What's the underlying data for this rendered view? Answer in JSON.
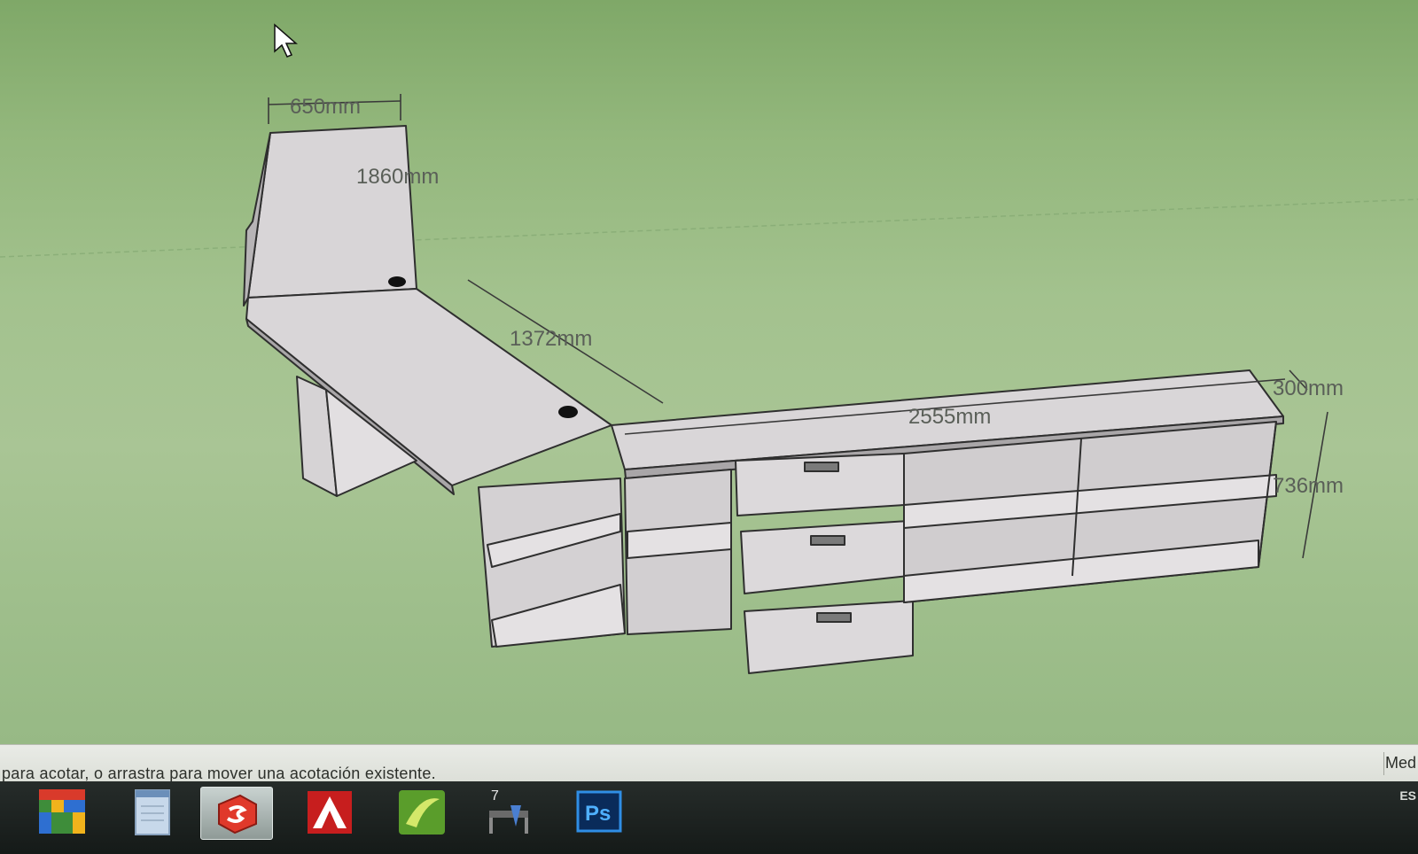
{
  "viewport": {
    "dimensions": {
      "depth_top": "650mm",
      "length_top": "1860mm",
      "length_mid": "1372mm",
      "length_main": "2555mm",
      "depth_main": "300mm",
      "height_main": "736mm"
    }
  },
  "statusbar": {
    "text": "para acotar, o arrastra para mover una acotación existente.",
    "measure_label": "Med"
  },
  "taskbar": {
    "apps": [
      {
        "name": "start-button",
        "icon": "windows-start-icon"
      },
      {
        "name": "notepad",
        "icon": "notepad-icon"
      },
      {
        "name": "sketchup",
        "icon": "sketchup-icon",
        "active": true
      },
      {
        "name": "autocad",
        "icon": "autocad-icon"
      },
      {
        "name": "coreldraw",
        "icon": "coreldraw-icon"
      },
      {
        "name": "layout",
        "icon": "layout-icon"
      },
      {
        "name": "photoshop",
        "icon": "photoshop-icon",
        "label": "Ps"
      }
    ],
    "language": "ES"
  },
  "colors": {
    "viewport_bg": "#a3c28e",
    "furniture_face": "#d9d6d8",
    "furniture_edge": "#3a3a3a"
  }
}
